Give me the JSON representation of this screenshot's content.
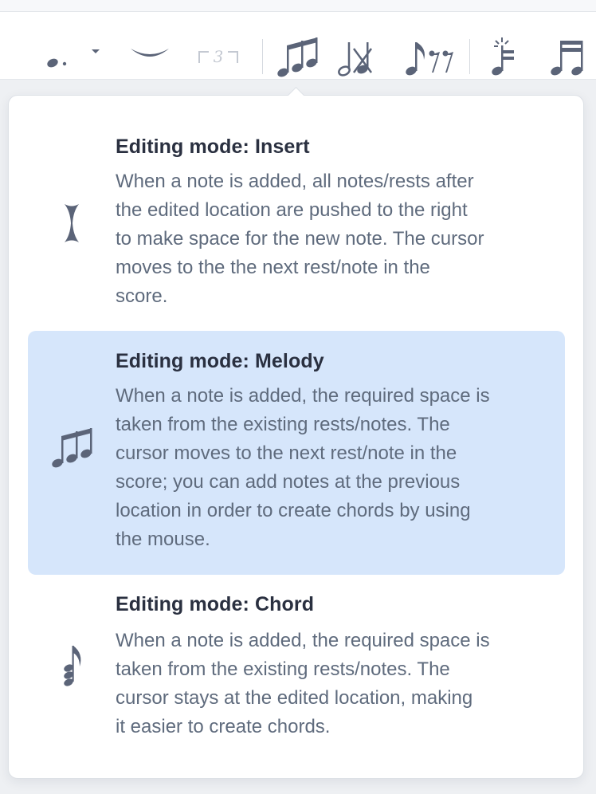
{
  "toolbar": {
    "tools": [
      {
        "name": "dotted-duration-icon",
        "interactable": true
      },
      {
        "name": "dropdown-chevron-icon",
        "interactable": true
      },
      {
        "name": "tie-icon",
        "interactable": true
      },
      {
        "name": "triplet-icon",
        "label": "3",
        "interactable": true
      },
      {
        "name": "melody-mode-icon",
        "interactable": true
      },
      {
        "name": "delete-note-icon",
        "interactable": true
      },
      {
        "name": "rests-icon",
        "interactable": true
      },
      {
        "name": "magic-note-icon",
        "interactable": true
      },
      {
        "name": "beamed-notes-icon",
        "interactable": true
      }
    ]
  },
  "modes": [
    {
      "id": "insert",
      "icon": "text-cursor-icon",
      "title": "Editing mode: Insert",
      "desc_lines": [
        "When a note is added, all notes/rests after",
        "the edited location are pushed to the right",
        "to make space for the new note. The cursor",
        "moves to the the next rest/note in the",
        "score."
      ],
      "selected": false
    },
    {
      "id": "melody",
      "icon": "melody-notes-icon",
      "title": "Editing mode: Melody",
      "desc_lines": [
        "When a note is added, the required space is",
        "taken from the existing rests/notes. The",
        "cursor moves to the next rest/note in the",
        "score; you can add notes at the previous",
        "location in order to create chords by using",
        "the mouse."
      ],
      "selected": true
    },
    {
      "id": "chord",
      "icon": "chord-note-icon",
      "title": "Editing mode: Chord",
      "desc_lines": [
        "When a note is added, the required space is",
        "taken from the existing rests/notes. The",
        "cursor stays at the edited location, making",
        "it easier to create chords."
      ],
      "selected": false
    }
  ],
  "colors": {
    "icon": "#5b6478",
    "icon_faint": "#c4c9d2",
    "selected_bg": "#d6e6fb",
    "title": "#2a3040",
    "desc": "#5f6b7d"
  }
}
